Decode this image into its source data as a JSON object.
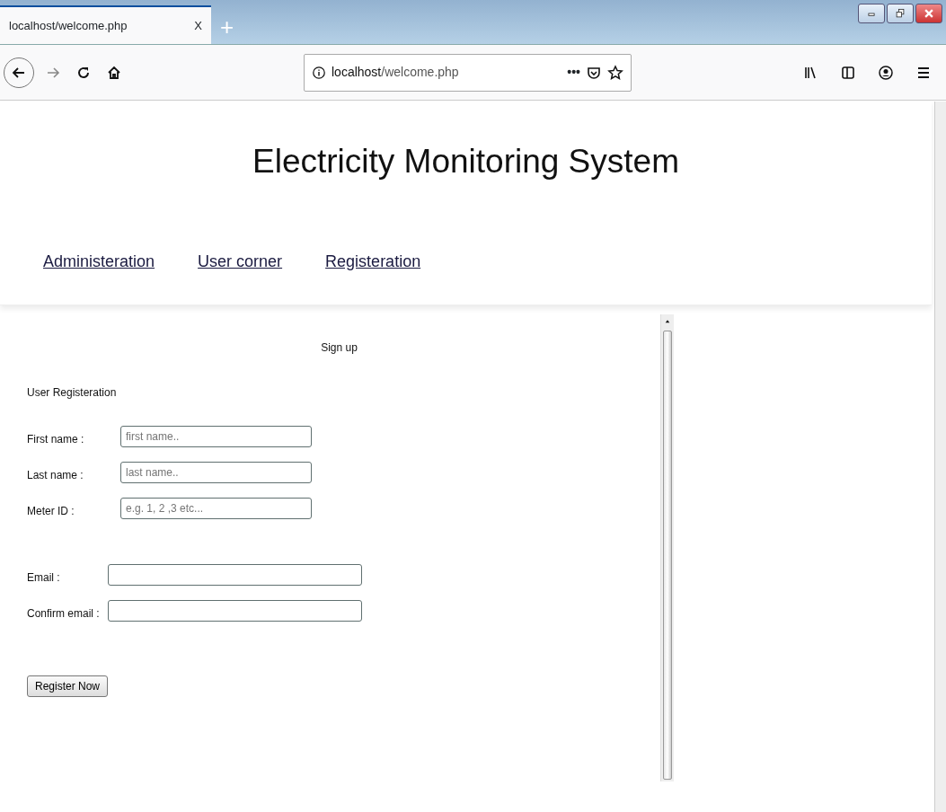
{
  "browser": {
    "tab": {
      "title": "localhost/welcome.php",
      "close": "X"
    },
    "new_tab": "+",
    "address": "**localhost**/welcome.php",
    "page_actions": "•••"
  },
  "page": {
    "title": "Electricity Monitoring System",
    "nav": [
      {
        "label": "Administeration"
      },
      {
        "label": "User corner"
      },
      {
        "label": "Registeration"
      }
    ]
  },
  "form": {
    "heading": "Sign up",
    "section": "User Registeration",
    "groups": [
      [
        {
          "label": "First name :",
          "placeholder": "first name.."
        },
        {
          "label": "Last name :",
          "placeholder": "last name.."
        },
        {
          "label": "Meter ID :",
          "placeholder": "e.g. 1, 2 ,3 etc..."
        }
      ],
      [
        {
          "label": "Email :"
        },
        {
          "label": "Confirm email :"
        }
      ]
    ],
    "button": "Register Now"
  }
}
